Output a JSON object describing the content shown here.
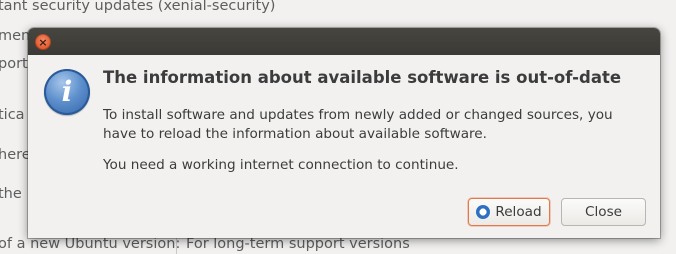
{
  "background": {
    "top_text": "tant security updates (xenial-security)",
    "line1": "men",
    "line2": "port",
    "line3": "tica",
    "line4": "here",
    "line5": " the",
    "bottom_label": "of a new Ubuntu version:",
    "bottom_value": "For long-term support versions"
  },
  "dialog": {
    "close_glyph": "×",
    "icon_glyph": "i",
    "heading": "The information about available software is out-of-date",
    "body_line1": "To install software and updates from newly added or changed sources, you have to reload the information about available software.",
    "body_line2": "You need a working internet connection to continue.",
    "reload_label": "Reload",
    "close_label": "Close"
  }
}
